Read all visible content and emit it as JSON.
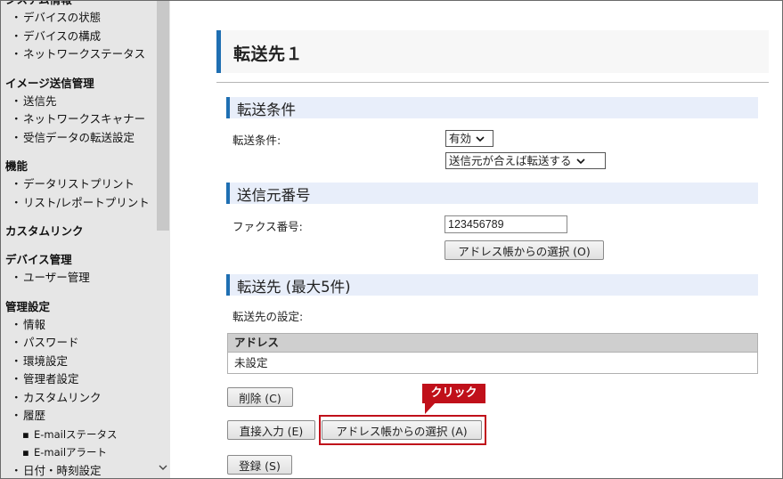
{
  "sidebar": {
    "sections": [
      {
        "title": "システム情報",
        "items": [
          "デバイスの状態",
          "デバイスの構成",
          "ネットワークステータス"
        ]
      },
      {
        "title": "イメージ送信管理",
        "items": [
          "送信先",
          "ネットワークスキャナー",
          "受信データの転送設定"
        ]
      },
      {
        "title": "機能",
        "items": [
          "データリストプリント",
          "リスト/レポートプリント"
        ]
      },
      {
        "title": "カスタムリンク",
        "items": []
      },
      {
        "title": "デバイス管理",
        "items": [
          "ユーザー管理"
        ]
      },
      {
        "title": "管理設定",
        "items": [
          "情報",
          "パスワード",
          "環境設定",
          "管理者設定",
          "カスタムリンク",
          "履歴"
        ],
        "subitems": [
          "E-mailステータス",
          "E-mailアラート"
        ],
        "trailing_item": "日付・時刻設定"
      }
    ],
    "bullet": "・",
    "sub_bullet": "▪"
  },
  "page": {
    "title": "転送先１"
  },
  "transfer_condition": {
    "heading": "転送条件",
    "label": "転送条件:",
    "select1_value": "有効",
    "select2_value": "送信元が合えば転送する"
  },
  "sender_number": {
    "heading": "送信元番号",
    "label": "ファクス番号:",
    "fax_value": "123456789",
    "address_book_button": "アドレス帳からの選択 (O)"
  },
  "destination": {
    "heading": "転送先 (最大5件)",
    "label": "転送先の設定:",
    "table_header": "アドレス",
    "table_value": "未設定",
    "delete_button": "削除 (C)",
    "direct_input_button": "直接入力 (E)",
    "address_book_button": "アドレス帳からの選択 (A)",
    "register_button": "登録 (S)"
  },
  "annotation": {
    "callout": "クリック"
  },
  "colors": {
    "accent": "#1f6fb2",
    "highlight": "#c0101a",
    "section_bg": "#e8eefa",
    "sidebar_bg": "#e6e6e6"
  }
}
